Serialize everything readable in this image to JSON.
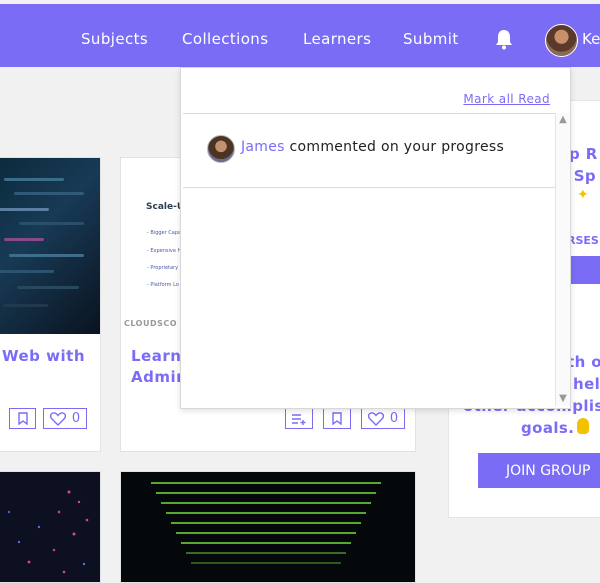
{
  "nav": {
    "links": [
      "Subjects",
      "Collections",
      "Learners",
      "Submit"
    ],
    "user_fragment": "Ke"
  },
  "notifications": {
    "mark_all_read": "Mark all Read",
    "items": [
      {
        "actor": "James",
        "message": "commented on your progress"
      }
    ]
  },
  "cards": {
    "c1": {
      "title_line1": "Web with",
      "likes": "0"
    },
    "c2": {
      "title_line1": "Learn",
      "title_line2": "Admin",
      "likes": "0",
      "slide_title": "Scale-Up",
      "slide_bullets": [
        "- Bigger Capa",
        "- Expensive H",
        "- Proprietary",
        "- Platform Lo"
      ],
      "slide_logo": "CLOUDSCO"
    }
  },
  "promo": {
    "line1": "p R",
    "line2": "n Sp",
    "link": "RSES",
    "text1": "th o",
    "text2": "hel",
    "text3": "other accomplish",
    "text4": "goals.",
    "join_button": "JOIN GROUP"
  },
  "colors": {
    "accent": "#7b6cf6"
  }
}
